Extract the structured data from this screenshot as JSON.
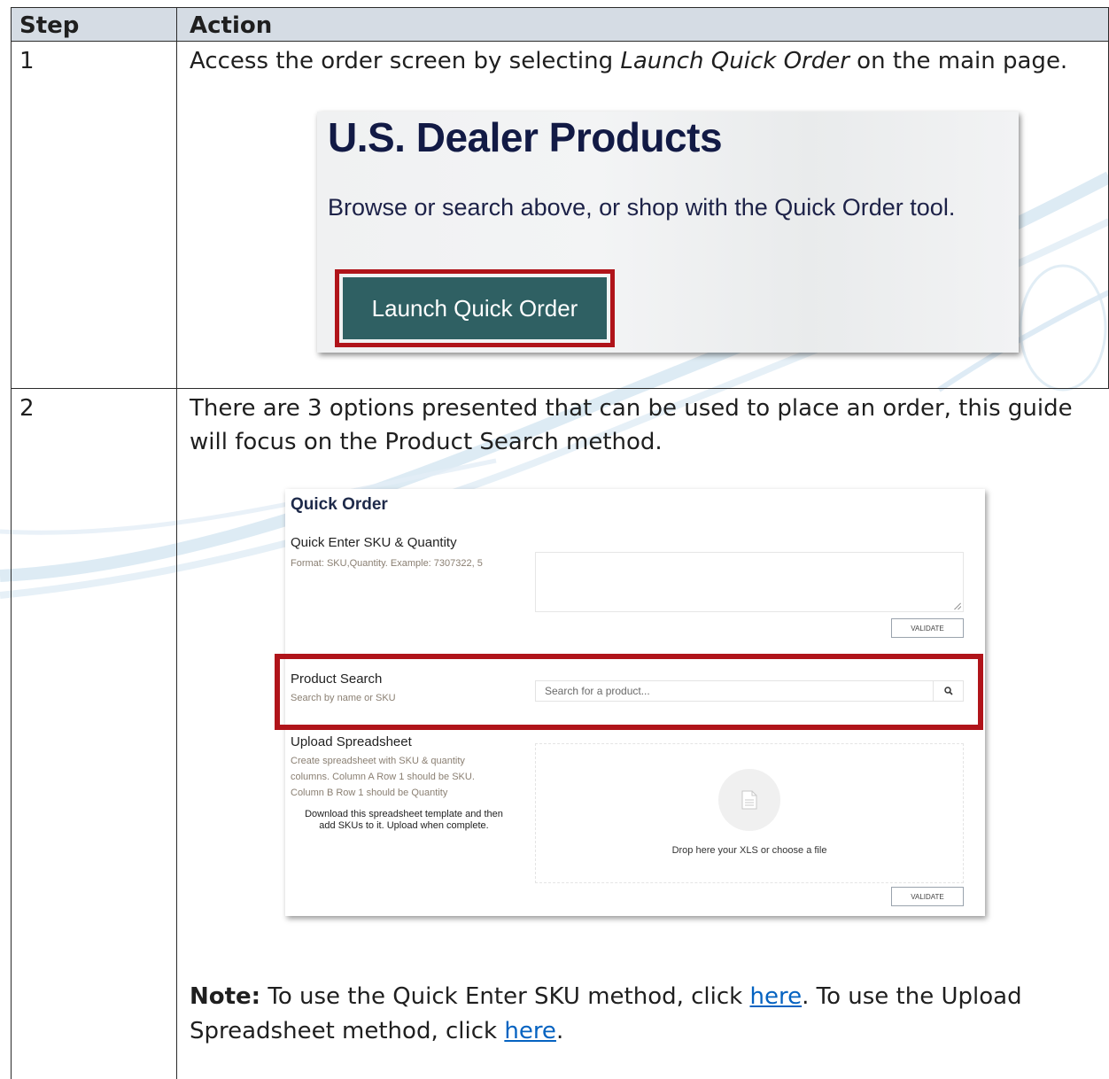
{
  "table": {
    "headers": {
      "step": "Step",
      "action": "Action"
    },
    "rows": [
      {
        "step": "1",
        "text_before": "Access the order screen by selecting ",
        "text_em": "Launch Quick Order",
        "text_after": " on the main page."
      },
      {
        "step": "2",
        "text_line1": "There are 3 options presented that can be used to place an order, this guide",
        "text_line2": "will focus on the Product Search method.",
        "note_label": "Note:",
        "note_text1": " To use the Quick Enter SKU method, click ",
        "note_link1": "here",
        "note_text2": ". To use the Upload",
        "note_text3": "Spreadsheet method, click ",
        "note_link2": "here",
        "note_text4": "."
      }
    ]
  },
  "dealer_screenshot": {
    "title": "U.S. Dealer Products",
    "subtitle": "Browse or search above, or shop with the Quick Order tool.",
    "launch_button": "Launch Quick Order",
    "highlight_color": "#b0141a",
    "button_color": "#2f6063"
  },
  "quick_order_screenshot": {
    "title": "Quick Order",
    "quick_enter": {
      "title": "Quick Enter SKU & Quantity",
      "desc": "Format: SKU,Quantity. Example: 7307322, 5",
      "validate": "VALIDATE"
    },
    "product_search": {
      "title": "Product Search",
      "desc": "Search by name or SKU",
      "placeholder": "Search for a product...",
      "icon": "search-icon"
    },
    "upload": {
      "title": "Upload Spreadsheet",
      "desc_line1": "Create spreadsheet with SKU & quantity",
      "desc_line2": "columns. Column A Row 1 should be SKU.",
      "desc_line3": "Column B Row 1 should be Quantity",
      "download_line1": "Download this spreadsheet template and then",
      "download_line2": "add SKUs to it. Upload when complete.",
      "drop_text": "Drop here your XLS or choose a file",
      "icon": "file-icon",
      "validate": "VALIDATE"
    }
  }
}
